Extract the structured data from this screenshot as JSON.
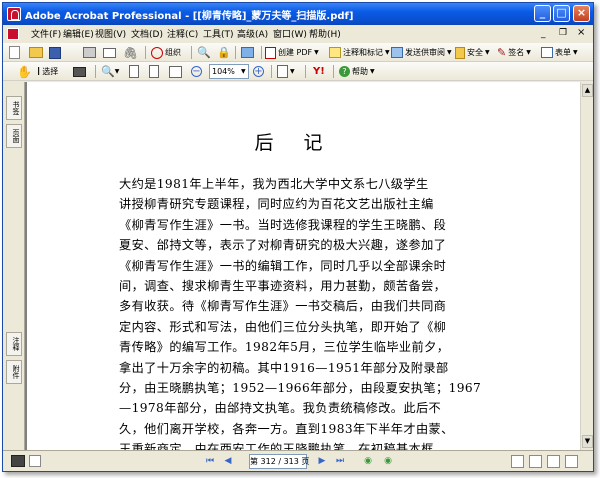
{
  "window": {
    "title": "Adobe Acrobat Professional - [[柳青传略]_蒙万夫等_扫描版.pdf]",
    "controls": [
      "_",
      "□",
      "×"
    ]
  },
  "menu": [
    {
      "label": "文件(F)"
    },
    {
      "label": "编辑(E)"
    },
    {
      "label": "视图(V)"
    },
    {
      "label": "文档(D)"
    },
    {
      "label": "注释(C)"
    },
    {
      "label": "工具(T)"
    },
    {
      "label": "高级(A)"
    },
    {
      "label": "窗口(W)"
    },
    {
      "label": "帮助(H)"
    }
  ],
  "toolbar1": {
    "organize_label": "组织",
    "create_pdf_label": "创建 PDF",
    "comment_label": "注释和标记",
    "review_label": "发送供审阅",
    "secure_label": "安全",
    "sign_label": "签名",
    "forms_label": "表单"
  },
  "toolbar2": {
    "select_label": "选择",
    "zoom_value": "104%",
    "help_label": "帮助"
  },
  "nav_tabs": [
    "书签",
    "页面",
    "注释",
    "附件"
  ],
  "document": {
    "heading": "后记",
    "lines": [
      "大约是1981年上半年，我为西北大学中文系七八级学生",
      "讲授柳青研究专题课程，同时应约为百花文艺出版社主编",
      "《柳青写作生涯》一书。当时选修我课程的学生王晓鹏、段",
      "夏安、邰持文等，表示了对柳青研究的极大兴趣，遂参加了",
      "《柳青写作生涯》一书的编辑工作，同时几乎以全部课余时",
      "间，调查、搜求柳青生平事迹资料，用力甚勤，颇苦备尝，",
      "多有收获。待《柳青写作生涯》一书交稿后，由我们共同商",
      "定内容、形式和写法，由他们三位分头执笔，即开始了《柳",
      "青传略》的编写工作。1982年5月，三位学生临毕业前夕，",
      "拿出了十万余字的初稿。其中1916—1951年部分及附录部",
      "分，由王晓鹏执笔；1952—1966年部分，由段夏安执笔；1967",
      "—1978年部分，由邰持文执笔。我负责统稿修改。此后不",
      "久，他们离开学校，各奔一方。直到1983年下半年才由蒙、",
      "王重新商定，由在西安工作的王晓鹏执笔，在初稿基本框"
    ]
  },
  "status": {
    "page_display": "第 312 / 313 页"
  }
}
